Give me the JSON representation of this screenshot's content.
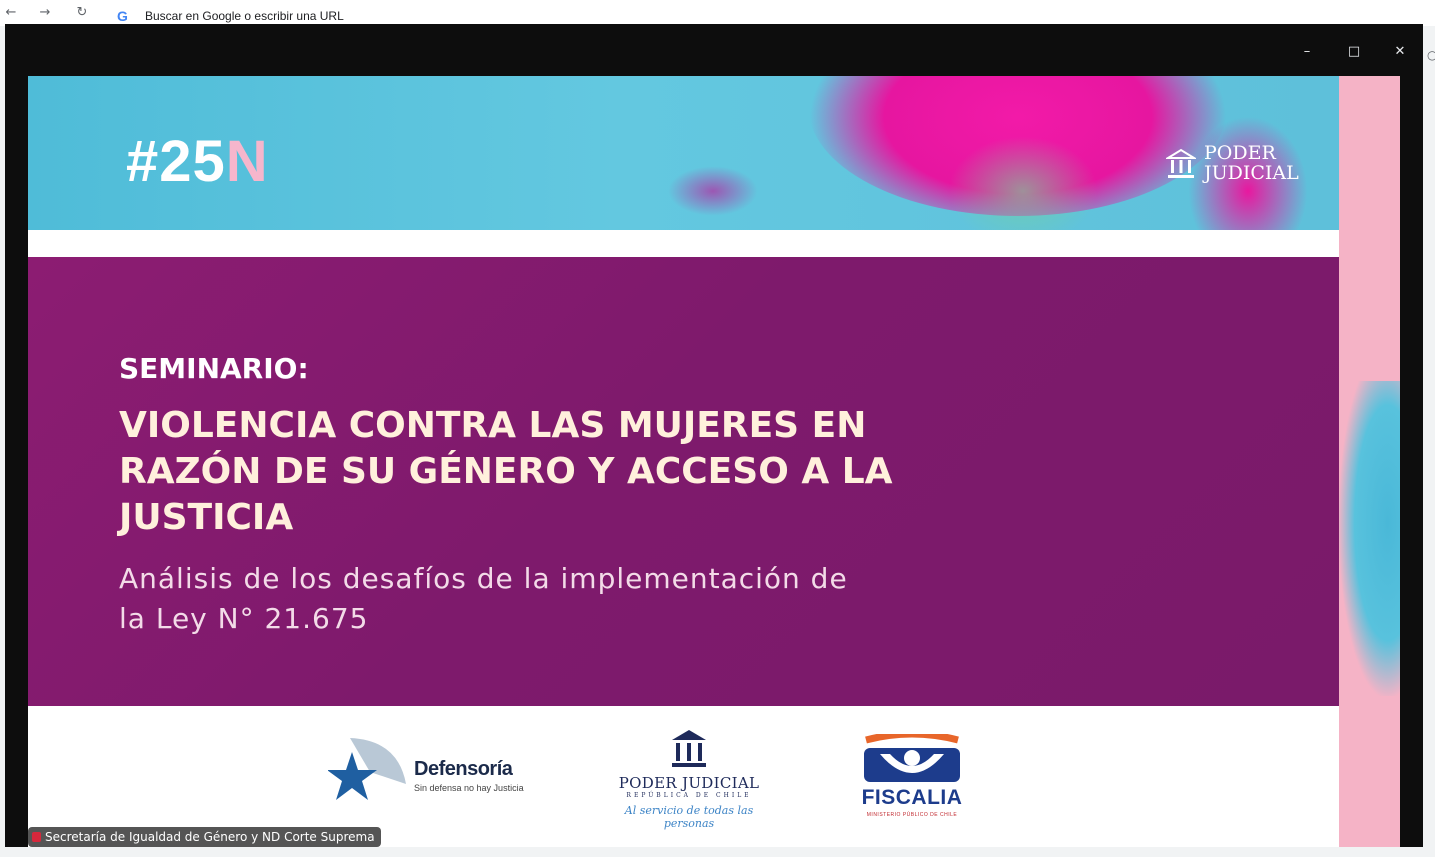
{
  "browser": {
    "omnibox_placeholder": "Buscar en Google o escribir una URL",
    "google_letter": "G"
  },
  "popup": {
    "buttons": [
      "minimize",
      "maximize",
      "close"
    ]
  },
  "slide": {
    "hashtag_main": "#25",
    "hashtag_accent": "N",
    "top_logo": {
      "line1": "PODER",
      "line2": "JUDICIAL"
    },
    "seminar_label": "SEMINARIO:",
    "title_lines": [
      "VIOLENCIA CONTRA LAS MUJERES EN",
      "RAZÓN DE SU GÉNERO Y ACCESO A LA",
      "JUSTICIA"
    ],
    "subtitle_lines": [
      "Análisis de los desafíos de la implementación de",
      "la Ley N° 21.675"
    ],
    "logos": {
      "defensoria": {
        "name": "Defensoría",
        "tagline": "Sin defensa no hay Justicia"
      },
      "poder_judicial": {
        "name": "PODER JUDICIAL",
        "country": "REPÚBLICA DE CHILE",
        "tagline": "Al servicio de todas las personas"
      },
      "fiscalia": {
        "name": "FISCALIA",
        "subtitle": "MINISTERIO PÚBLICO DE CHILE"
      }
    }
  },
  "channel_label": "Secretaría de Igualdad de Género y ND Corte Suprema",
  "colors": {
    "purple": "#7e1a6c",
    "cyan": "#5ec0da",
    "magenta": "#e616a0",
    "pink": "#f5b3c6",
    "title_text": "#fff0dc"
  }
}
